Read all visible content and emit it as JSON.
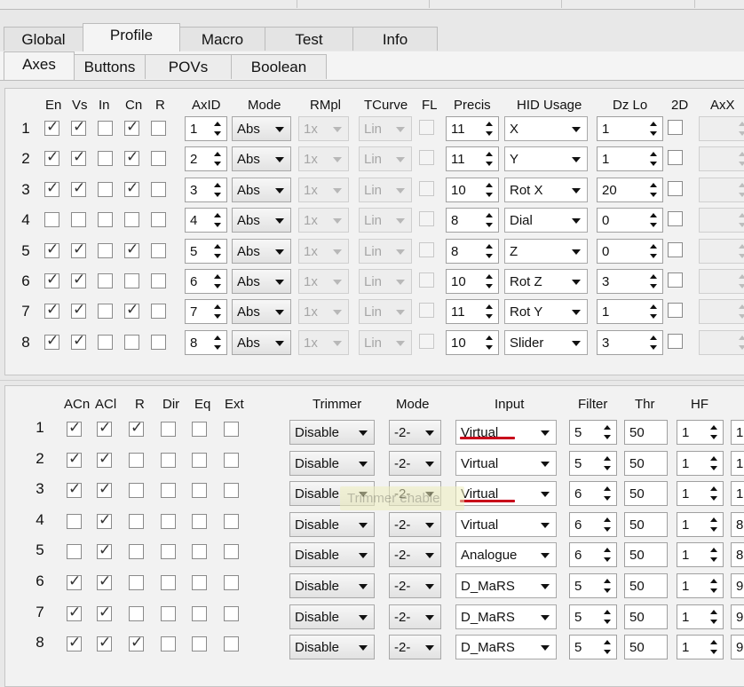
{
  "tabs": [
    "Global",
    "Profile",
    "Macro",
    "Test",
    "Info"
  ],
  "active_tab": "Profile",
  "subtabs": [
    "Axes",
    "Buttons",
    "POVs",
    "Boolean"
  ],
  "active_subtab": "Axes",
  "axes_panel": {
    "headers": {
      "en": "En",
      "vs": "Vs",
      "in": "In",
      "cn": "Cn",
      "r": "R",
      "axid": "AxID",
      "mode": "Mode",
      "rmpl": "RMpl",
      "tcurve": "TCurve",
      "fl": "FL",
      "precis": "Precis",
      "hid_usage": "HID Usage",
      "dz_lo": "Dz Lo",
      "twod": "2D",
      "axx": "AxX"
    },
    "rows": [
      {
        "num": "1",
        "en": true,
        "vs": true,
        "in": false,
        "cn": true,
        "r": false,
        "axid": "1",
        "mode": "Abs",
        "rmpl": "1x",
        "tcurve": "Lin",
        "fl": false,
        "precis": "11",
        "hid": "X",
        "dz_lo": "1",
        "twod": false
      },
      {
        "num": "2",
        "en": true,
        "vs": true,
        "in": false,
        "cn": true,
        "r": false,
        "axid": "2",
        "mode": "Abs",
        "rmpl": "1x",
        "tcurve": "Lin",
        "fl": false,
        "precis": "11",
        "hid": "Y",
        "dz_lo": "1",
        "twod": false
      },
      {
        "num": "3",
        "en": true,
        "vs": true,
        "in": false,
        "cn": true,
        "r": false,
        "axid": "3",
        "mode": "Abs",
        "rmpl": "1x",
        "tcurve": "Lin",
        "fl": false,
        "precis": "10",
        "hid": "Rot X",
        "dz_lo": "20",
        "twod": false
      },
      {
        "num": "4",
        "en": false,
        "vs": false,
        "in": false,
        "cn": false,
        "r": false,
        "axid": "4",
        "mode": "Abs",
        "rmpl": "1x",
        "tcurve": "Lin",
        "fl": false,
        "precis": "8",
        "hid": "Dial",
        "dz_lo": "0",
        "twod": false
      },
      {
        "num": "5",
        "en": true,
        "vs": true,
        "in": false,
        "cn": true,
        "r": false,
        "axid": "5",
        "mode": "Abs",
        "rmpl": "1x",
        "tcurve": "Lin",
        "fl": false,
        "precis": "8",
        "hid": "Z",
        "dz_lo": "0",
        "twod": false
      },
      {
        "num": "6",
        "en": true,
        "vs": true,
        "in": false,
        "cn": false,
        "r": false,
        "axid": "6",
        "mode": "Abs",
        "rmpl": "1x",
        "tcurve": "Lin",
        "fl": false,
        "precis": "10",
        "hid": "Rot Z",
        "dz_lo": "3",
        "twod": false
      },
      {
        "num": "7",
        "en": true,
        "vs": true,
        "in": false,
        "cn": true,
        "r": false,
        "axid": "7",
        "mode": "Abs",
        "rmpl": "1x",
        "tcurve": "Lin",
        "fl": false,
        "precis": "11",
        "hid": "Rot Y",
        "dz_lo": "1",
        "twod": false
      },
      {
        "num": "8",
        "en": true,
        "vs": true,
        "in": false,
        "cn": false,
        "r": false,
        "axid": "8",
        "mode": "Abs",
        "rmpl": "1x",
        "tcurve": "Lin",
        "fl": false,
        "precis": "10",
        "hid": "Slider",
        "dz_lo": "3",
        "twod": false
      }
    ]
  },
  "input_panel": {
    "headers": {
      "acn": "ACn",
      "acl": "ACl",
      "r": "R",
      "dir": "Dir",
      "eq": "Eq",
      "ext": "Ext",
      "trimmer": "Trimmer",
      "mode": "Mode",
      "input": "Input",
      "filter": "Filter",
      "thr": "Thr",
      "hf": "HF"
    },
    "rows": [
      {
        "num": "1",
        "acn": true,
        "acl": true,
        "r": true,
        "dir": false,
        "eq": false,
        "ext": false,
        "trimmer": "Disable",
        "mode": "-2-",
        "input": "Virtual",
        "filter": "5",
        "thr": "50",
        "hf": "1",
        "next": "1"
      },
      {
        "num": "2",
        "acn": true,
        "acl": true,
        "r": false,
        "dir": false,
        "eq": false,
        "ext": false,
        "trimmer": "Disable",
        "mode": "-2-",
        "input": "Virtual",
        "filter": "5",
        "thr": "50",
        "hf": "1",
        "next": "1"
      },
      {
        "num": "3",
        "acn": true,
        "acl": true,
        "r": false,
        "dir": false,
        "eq": false,
        "ext": false,
        "trimmer": "Disable",
        "mode": "-2-",
        "input": "Virtual",
        "filter": "6",
        "thr": "50",
        "hf": "1",
        "next": "1"
      },
      {
        "num": "4",
        "acn": false,
        "acl": true,
        "r": false,
        "dir": false,
        "eq": false,
        "ext": false,
        "trimmer": "Disable",
        "mode": "-2-",
        "input": "Virtual",
        "filter": "6",
        "thr": "50",
        "hf": "1",
        "next": "8"
      },
      {
        "num": "5",
        "acn": false,
        "acl": true,
        "r": false,
        "dir": false,
        "eq": false,
        "ext": false,
        "trimmer": "Disable",
        "mode": "-2-",
        "input": "Analogue",
        "filter": "6",
        "thr": "50",
        "hf": "1",
        "next": "8"
      },
      {
        "num": "6",
        "acn": true,
        "acl": true,
        "r": false,
        "dir": false,
        "eq": false,
        "ext": false,
        "trimmer": "Disable",
        "mode": "-2-",
        "input": "D_MaRS",
        "filter": "5",
        "thr": "50",
        "hf": "1",
        "next": "9"
      },
      {
        "num": "7",
        "acn": true,
        "acl": true,
        "r": false,
        "dir": false,
        "eq": false,
        "ext": false,
        "trimmer": "Disable",
        "mode": "-2-",
        "input": "D_MaRS",
        "filter": "5",
        "thr": "50",
        "hf": "1",
        "next": "9"
      },
      {
        "num": "8",
        "acn": true,
        "acl": true,
        "r": true,
        "dir": false,
        "eq": false,
        "ext": false,
        "trimmer": "Disable",
        "mode": "-2-",
        "input": "D_MaRS",
        "filter": "5",
        "thr": "50",
        "hf": "1",
        "next": "9"
      }
    ]
  },
  "tooltip": "Trimmer enable",
  "annotation_color": "#c8001a"
}
